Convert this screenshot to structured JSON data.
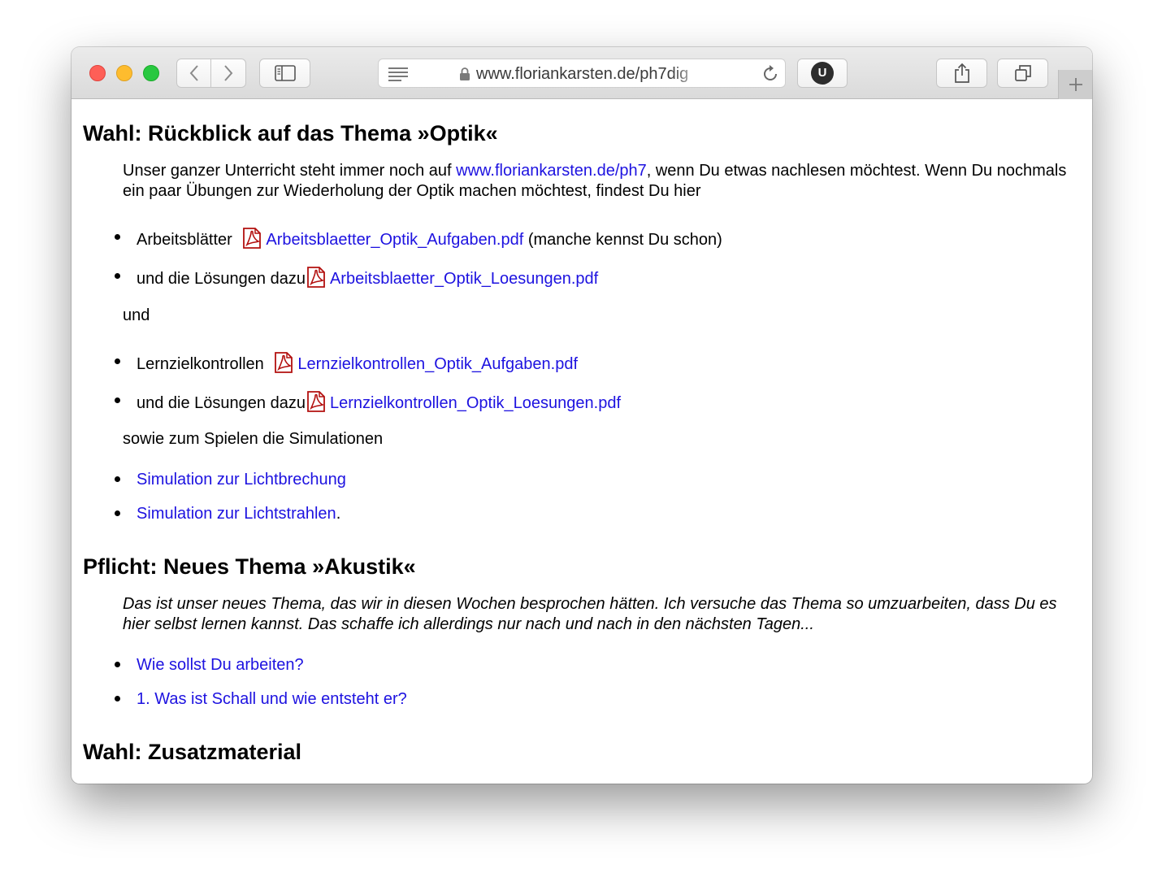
{
  "browser": {
    "address": "www.floriankarsten.de/ph7dig",
    "extension_label": "U",
    "colors": {
      "close": "#fe5f57",
      "minimize": "#febc2e",
      "zoom": "#28c840",
      "link": "#1d12e0"
    }
  },
  "page": {
    "section1": {
      "heading": "Wahl: Rückblick auf das Thema »Optik«",
      "intro_before": "Unser ganzer Unterricht steht immer noch auf ",
      "intro_link": "www.floriankarsten.de/ph7",
      "intro_after": ", wenn Du etwas nachlesen möchtest. Wenn Du nochmals ein paar Übungen zur Wiederholung der Optik machen möchtest, findest Du hier",
      "list1": [
        {
          "prefix": "Arbeitsblätter ",
          "link": "Arbeitsblaetter_Optik_Aufgaben.pdf",
          "suffix": " (manche kennst Du schon)"
        },
        {
          "prefix": "und die Lösungen dazu",
          "link": "Arbeitsblaetter_Optik_Loesungen.pdf",
          "suffix": ""
        }
      ],
      "connector": "und",
      "list2": [
        {
          "prefix": "Lernzielkontrollen ",
          "link": "Lernzielkontrollen_Optik_Aufgaben.pdf",
          "suffix": ""
        },
        {
          "prefix": "und die Lösungen dazu",
          "link": "Lernzielkontrollen_Optik_Loesungen.pdf",
          "suffix": ""
        }
      ],
      "sim_intro": "sowie zum Spielen die Simulationen",
      "simulations": [
        {
          "link": "Simulation zur Lichtbrechung",
          "suffix": ""
        },
        {
          "link": "Simulation zur Lichtstrahlen",
          "suffix": "."
        }
      ]
    },
    "section2": {
      "heading": "Pflicht: Neues Thema »Akustik«",
      "intro": "Das ist unser neues Thema, das wir in diesen Wochen besprochen hätten. Ich versuche das Thema so umzuarbeiten, dass Du es hier selbst lernen kannst. Das schaffe ich allerdings nur nach und nach in den nächsten Tagen...",
      "links": [
        "Wie sollst Du arbeiten?",
        "1. Was ist Schall und wie entsteht er?"
      ]
    },
    "section3": {
      "heading": "Wahl: Zusatzmaterial"
    }
  }
}
